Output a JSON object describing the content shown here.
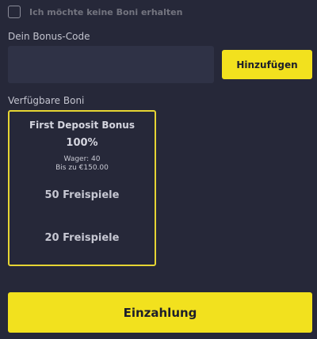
{
  "opt_out": {
    "label": "Ich möchte keine Boni erhalten",
    "checked": false
  },
  "bonus_code": {
    "label": "Dein Bonus-Code",
    "value": "",
    "add_button_label": "Hinzufügen"
  },
  "available_bonuses": {
    "label": "Verfügbare Boni",
    "items": [
      {
        "title": "First Deposit Bonus",
        "percent": "100%",
        "wager": "Wager: 40",
        "max": "Bis zu €150.00",
        "free_spins_1": "50 Freispiele",
        "free_spins_2": "20 Freispiele",
        "selected": true
      }
    ]
  },
  "deposit_button_label": "Einzahlung",
  "colors": {
    "background": "#262839",
    "accent": "#f2e11e",
    "card_border": "#e6d533",
    "input_bg": "#2f3246"
  }
}
